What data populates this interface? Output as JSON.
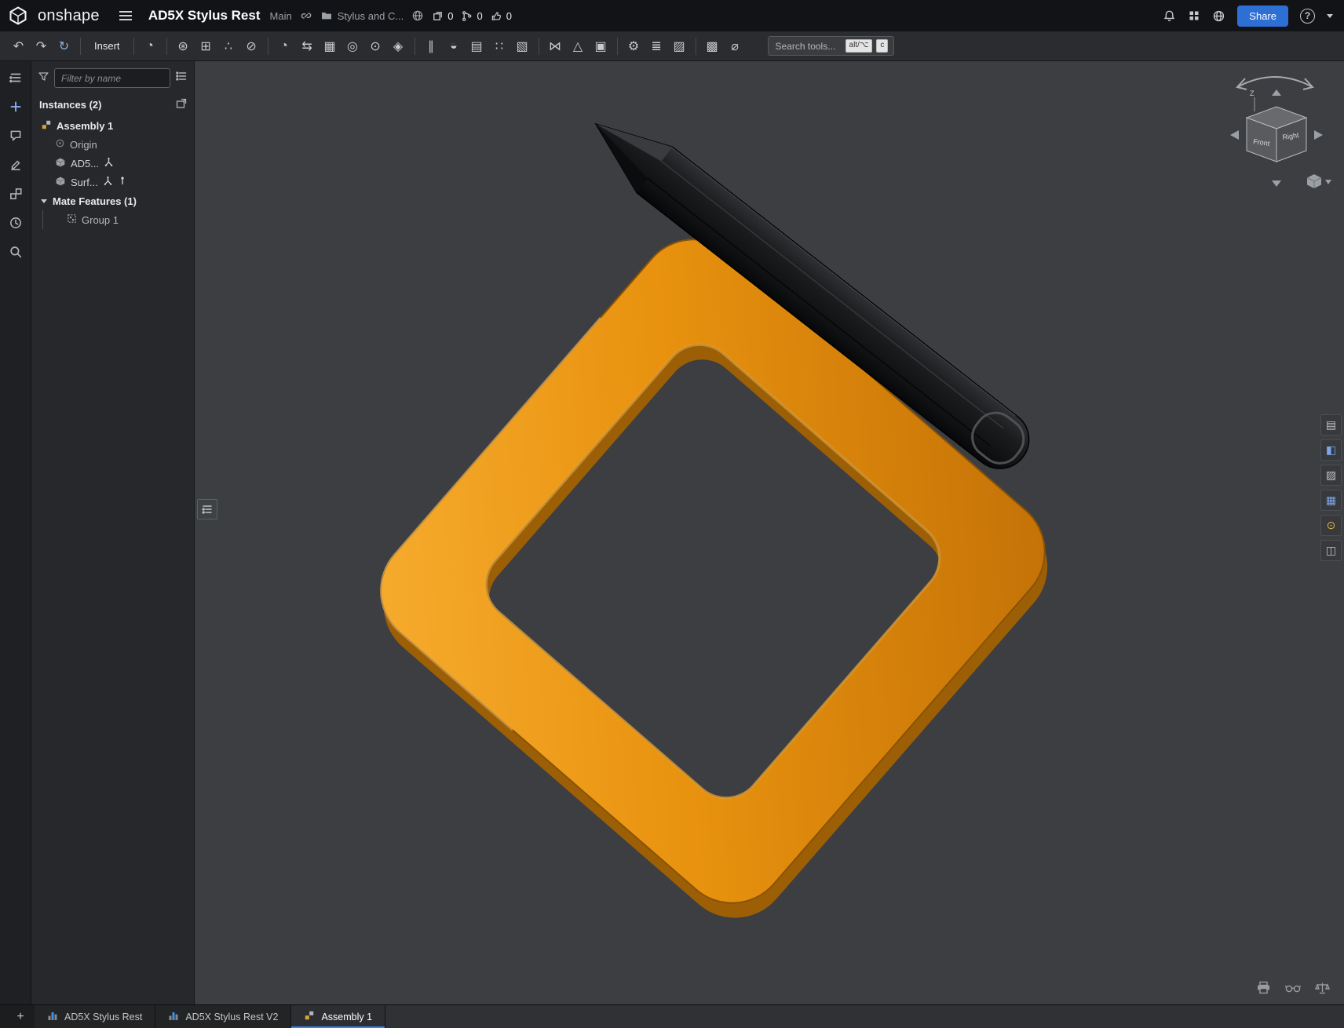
{
  "header": {
    "brand": "onshape",
    "doc_title": "AD5X Stylus Rest",
    "workspace": "Main",
    "folder_name": "Stylus and C...",
    "copy_count": "0",
    "version_count": "0",
    "like_count": "0",
    "share_label": "Share",
    "help_glyph": "?"
  },
  "toolbar": {
    "undo_glyph": "↶",
    "redo_glyph": "↷",
    "sync_glyph": "↻",
    "insert_label": "Insert",
    "rotate_glyph": "◔",
    "icons": [
      {
        "name": "mate-icon",
        "glyph": "⊛"
      },
      {
        "name": "group-icon",
        "glyph": "⊞"
      },
      {
        "name": "mate-connector-icon",
        "glyph": "∴"
      },
      {
        "name": "fasten-icon",
        "glyph": "⊘"
      },
      {
        "name": "revolute-icon",
        "glyph": "◔"
      },
      {
        "name": "slider-icon",
        "glyph": "⇆"
      },
      {
        "name": "planar-icon",
        "glyph": "▦"
      },
      {
        "name": "cylindrical-icon",
        "glyph": "◎"
      },
      {
        "name": "ball-icon",
        "glyph": "⊙"
      },
      {
        "name": "pin-slot-icon",
        "glyph": "◈"
      },
      {
        "name": "parallel-icon",
        "glyph": "∥"
      },
      {
        "name": "tangent-icon",
        "glyph": "◒"
      },
      {
        "name": "linear-pattern-icon",
        "glyph": "▤"
      },
      {
        "name": "circular-pattern-icon",
        "glyph": "∷"
      },
      {
        "name": "mirror-icon",
        "glyph": "▧"
      },
      {
        "name": "replicate-icon",
        "glyph": "⋈"
      },
      {
        "name": "explode-icon",
        "glyph": "△"
      },
      {
        "name": "snapshot-icon",
        "glyph": "▣"
      },
      {
        "name": "gear-icon",
        "glyph": "⚙"
      },
      {
        "name": "named-positions-icon",
        "glyph": "≣"
      },
      {
        "name": "display-states-icon",
        "glyph": "▨"
      },
      {
        "name": "bom-icon",
        "glyph": "▩"
      },
      {
        "name": "measure-icon",
        "glyph": "⌀"
      }
    ],
    "search_placeholder": "Search tools...",
    "kbd_alt": "alt/⌥",
    "kbd_c": "c"
  },
  "side_nav": {
    "icons": [
      "outline-icon",
      "insert-plus-icon",
      "comment-icon",
      "edit-icon",
      "parts-icon",
      "history-icon",
      "search-icon"
    ]
  },
  "left_panel": {
    "filter_placeholder": "Filter by name",
    "instances_label": "Instances (2)",
    "tree": [
      {
        "label": "Assembly 1"
      },
      {
        "label": "Origin"
      },
      {
        "label": "AD5..."
      },
      {
        "label": "Surf..."
      },
      {
        "label": "Mate Features (1)"
      },
      {
        "label": "Group 1"
      }
    ]
  },
  "viewport": {
    "viewcube": {
      "front_label": "Front",
      "right_label": "Right",
      "axis_label": "Z"
    }
  },
  "tabs": {
    "plus_glyph": "+",
    "items": [
      {
        "label": "AD5X Stylus Rest"
      },
      {
        "label": "AD5X Stylus Rest V2"
      },
      {
        "label": "Assembly 1"
      }
    ]
  },
  "colors": {
    "accent_blue": "#2e6fd6",
    "model_orange": "#e8920f",
    "pen_black": "#141416",
    "viewport_bg": "#3c3e41"
  }
}
